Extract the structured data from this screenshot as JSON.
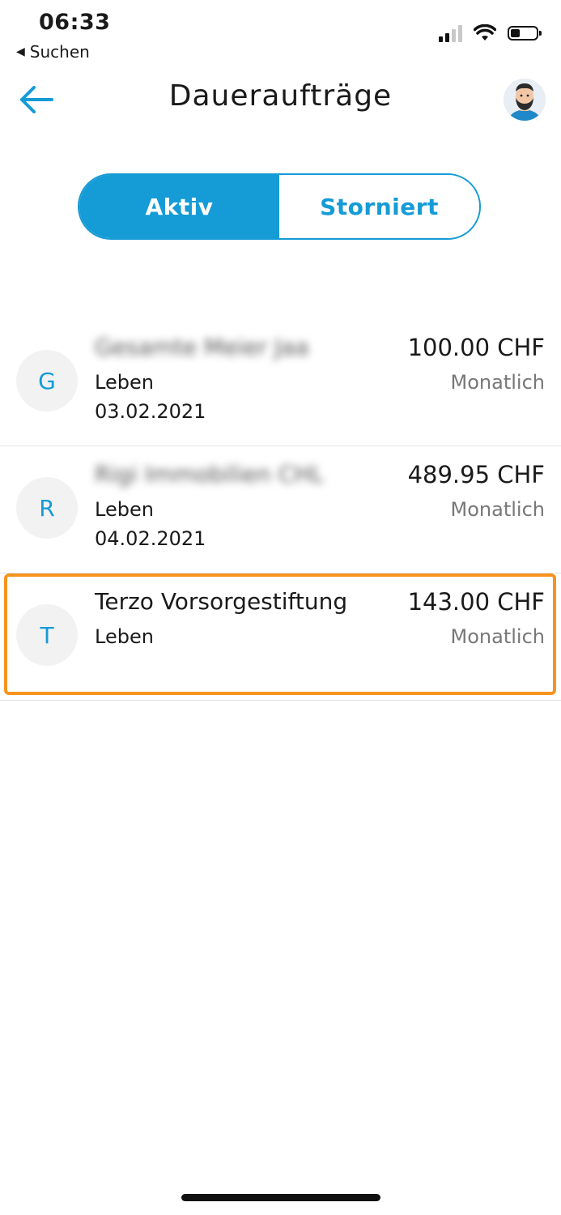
{
  "status_bar": {
    "time": "06:33",
    "back_app": "Suchen"
  },
  "header": {
    "title": "Daueraufträge"
  },
  "segment": {
    "active_label": "Aktiv",
    "inactive_label": "Storniert"
  },
  "orders": [
    {
      "initial": "G",
      "name": "Gesamte Meier Jaa",
      "category": "Leben",
      "date": "03.02.2021",
      "amount": "100.00 CHF",
      "frequency": "Monatlich"
    },
    {
      "initial": "R",
      "name": "Rigi Immobilien CHL",
      "category": "Leben",
      "date": "04.02.2021",
      "amount": "489.95 CHF",
      "frequency": "Monatlich"
    },
    {
      "initial": "T",
      "name": "Terzo Vorsorgestiftung",
      "category": "Leben",
      "date": "",
      "amount": "143.00 CHF",
      "frequency": "Monatlich"
    }
  ],
  "colors": {
    "accent": "#159bd6",
    "highlight": "#f7931e"
  }
}
